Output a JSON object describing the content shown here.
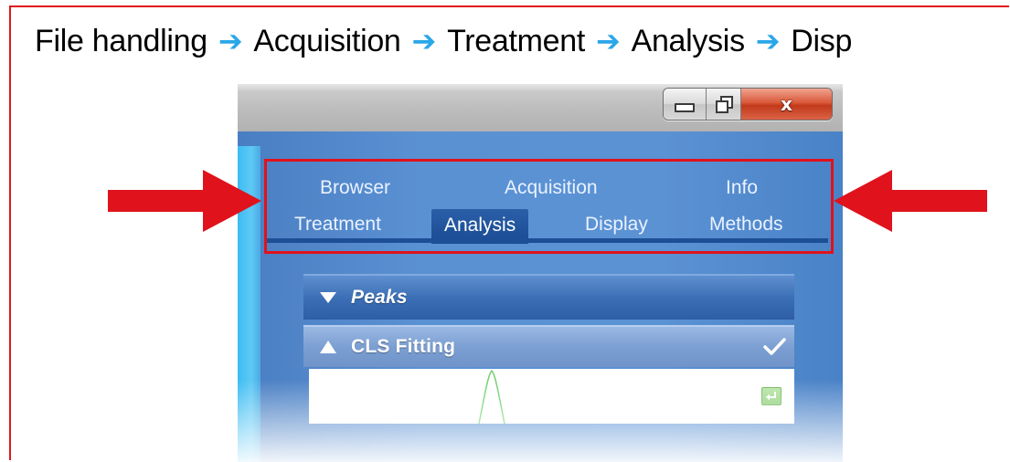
{
  "workflow": {
    "steps": [
      "File handling",
      "Acquisition",
      "Treatment",
      "Analysis",
      "Disp"
    ],
    "arrow_color": "#2aa7e8"
  },
  "window": {
    "buttons": {
      "minimize_icon": "minimize-icon",
      "maximize_icon": "restore-icon",
      "close_label": "x"
    }
  },
  "tabs": {
    "row1": [
      "Browser",
      "Acquisition",
      "Info"
    ],
    "row2": [
      "Treatment",
      "Analysis",
      "Display",
      "Methods"
    ],
    "active": "Analysis"
  },
  "panels": {
    "peaks": {
      "label": "Peaks",
      "state": "expanded"
    },
    "cls_fitting": {
      "label": "CLS Fitting",
      "state": "collapsed",
      "checked": true
    }
  },
  "annotations": {
    "highlight_color": "#e0121b",
    "left_arrow": "arrow-right-icon",
    "right_arrow": "arrow-left-icon"
  },
  "colors": {
    "tab_bar": "#5b92d4",
    "active_tab": "#1a4b93",
    "plot_line": "#6dd16d"
  }
}
